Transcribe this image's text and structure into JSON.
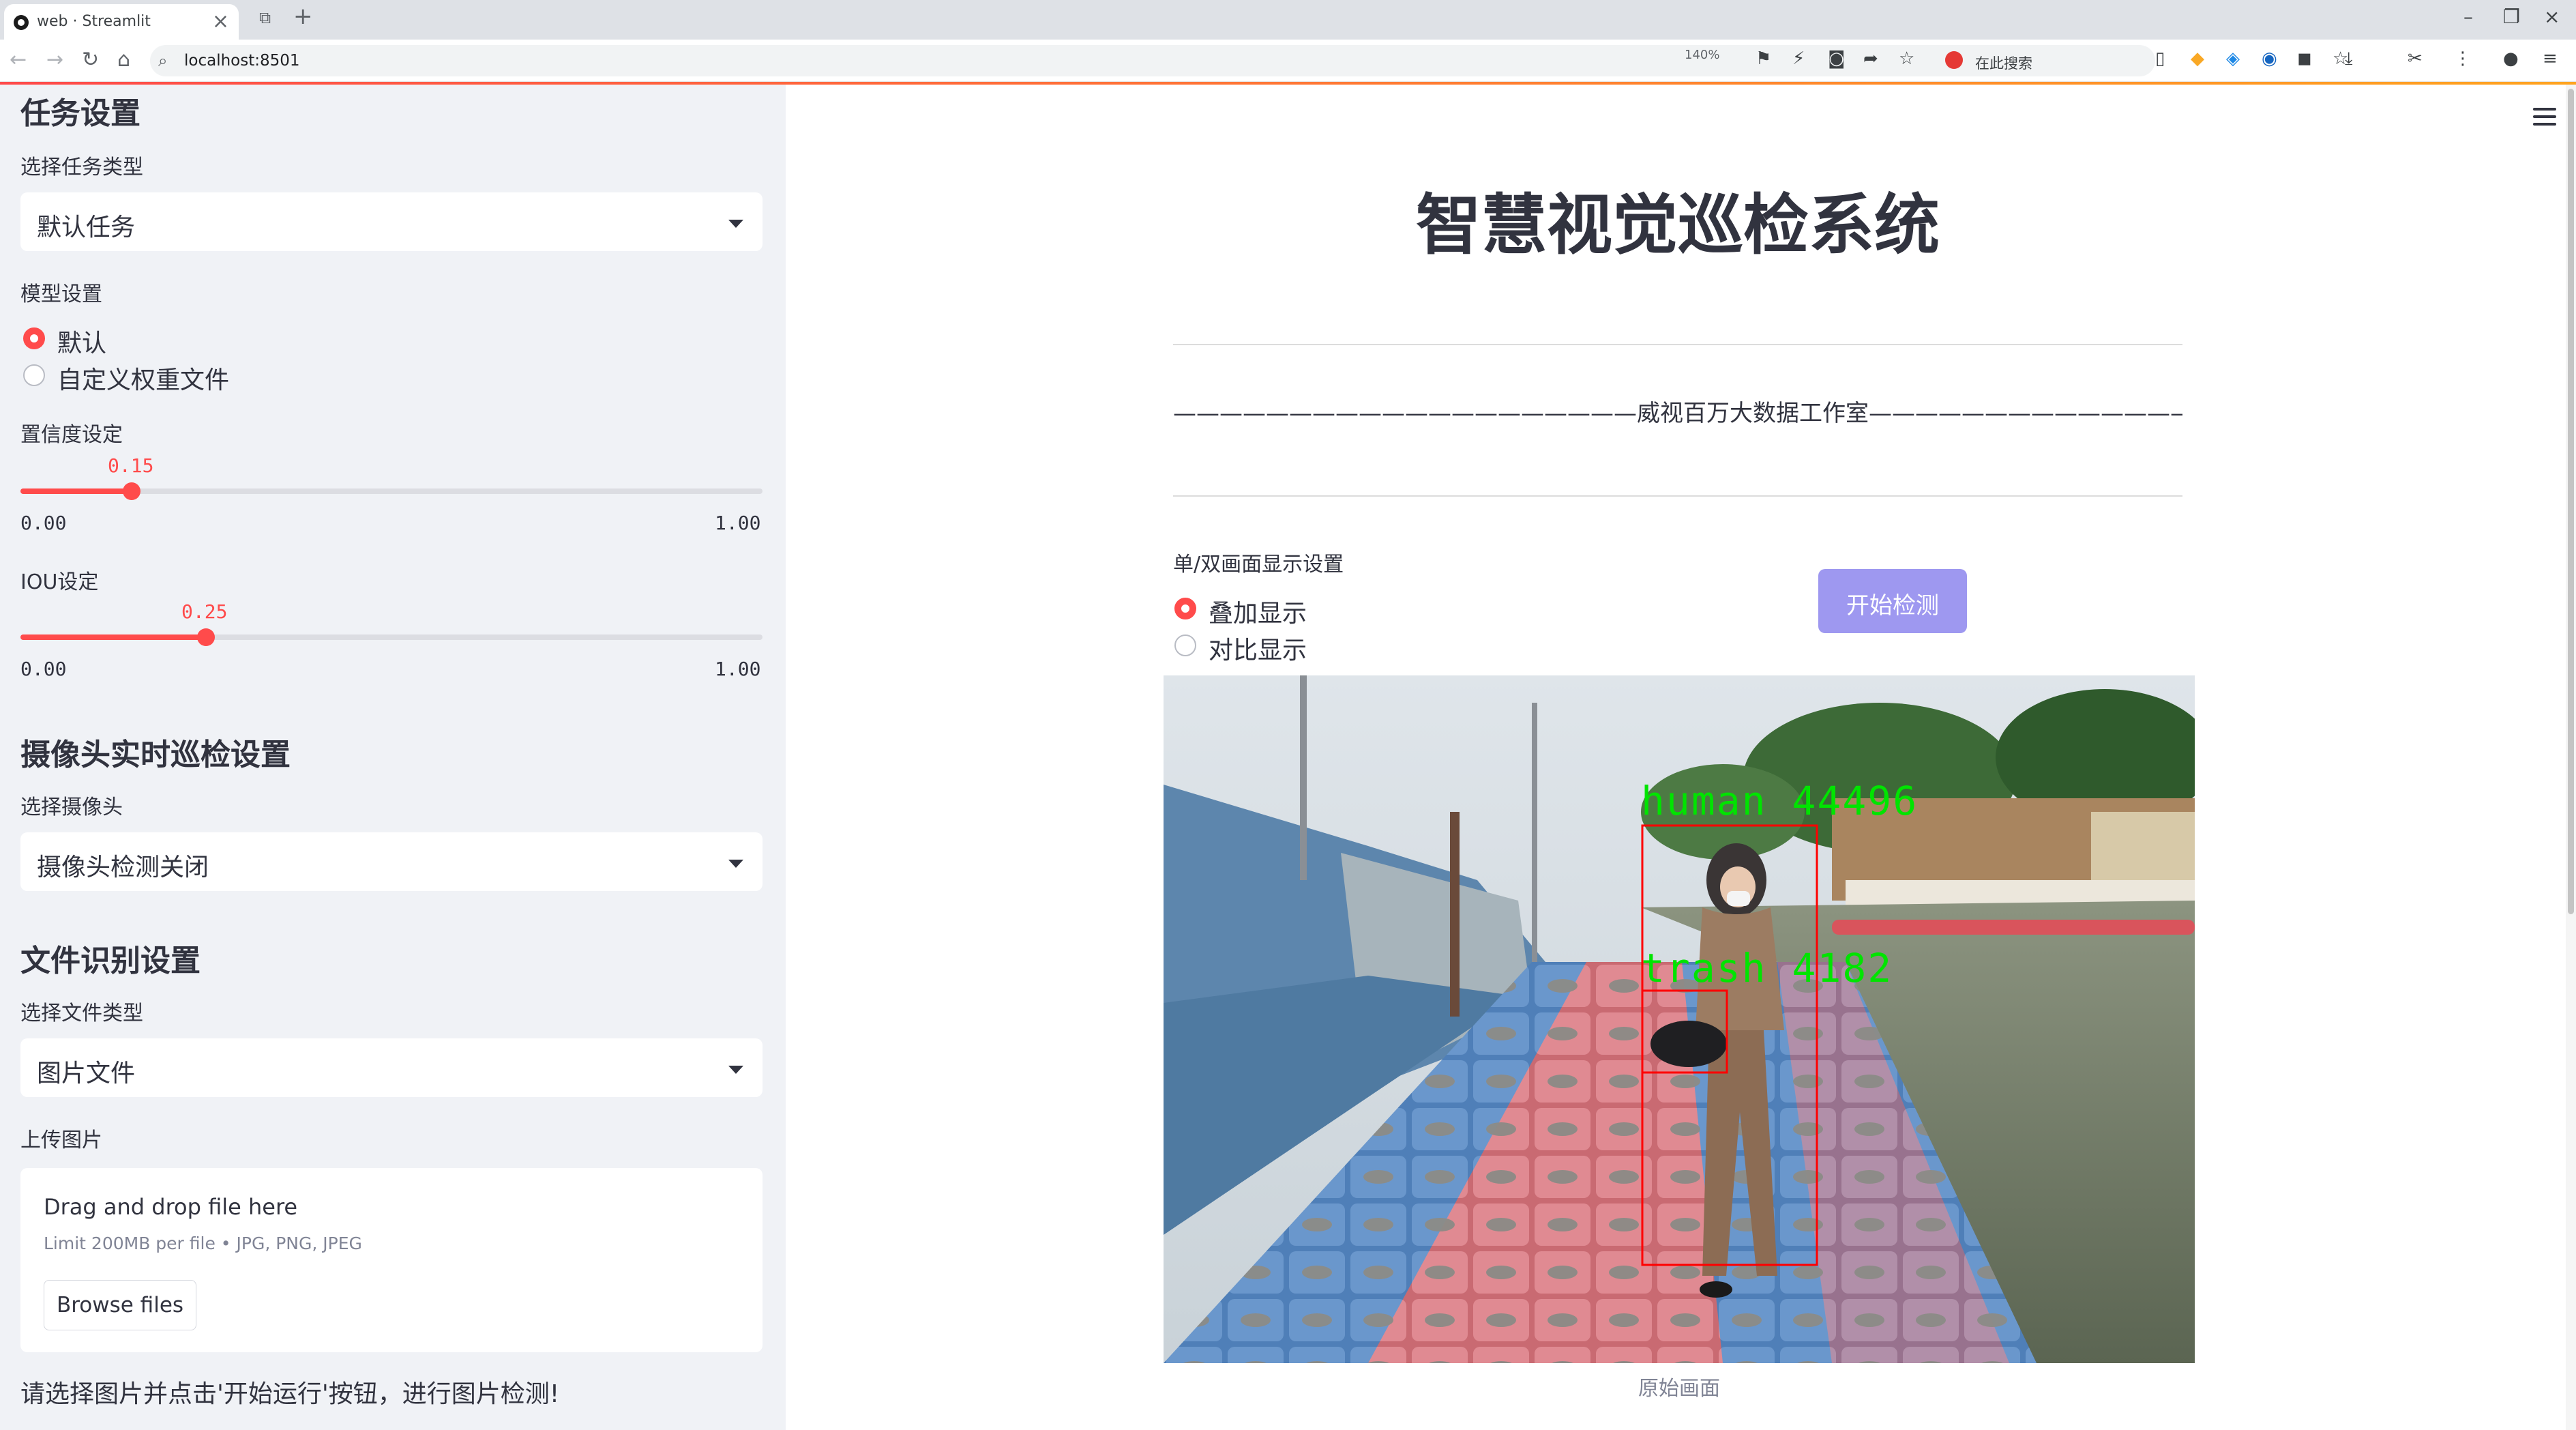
{
  "browser": {
    "tab_title": "web · Streamlit",
    "url": "localhost:8501",
    "zoom": "140%",
    "search_text": "在此搜索"
  },
  "sidebar": {
    "task_section": {
      "heading": "任务设置",
      "select_label": "选择任务类型",
      "select_value": "默认任务"
    },
    "model_section": {
      "label": "模型设置",
      "options": [
        "默认",
        "自定义权重文件"
      ],
      "selected_index": 0
    },
    "confidence": {
      "label": "置信度设定",
      "value_text": "0.15",
      "value": 0.15,
      "min": "0.00",
      "max": "1.00"
    },
    "iou": {
      "label": "IOU设定",
      "value_text": "0.25",
      "value": 0.25,
      "min": "0.00",
      "max": "1.00"
    },
    "camera_section": {
      "heading": "摄像头实时巡检设置",
      "select_label": "选择摄像头",
      "select_value": "摄像头检测关闭"
    },
    "file_section": {
      "heading": "文件识别设置",
      "select_label": "选择文件类型",
      "select_value": "图片文件"
    },
    "upload": {
      "label": "上传图片",
      "drop_text": "Drag and drop file here",
      "limit_text": "Limit 200MB per file • JPG, PNG, JPEG",
      "button_label": "Browse files"
    },
    "note": "请选择图片并点击'开始运行'按钮，进行图片检测!"
  },
  "main": {
    "title": "智慧视觉巡检系统",
    "studio_line": "————————————————————威视百万大数据工作室—————————————————————",
    "display_mode": {
      "label": "单/双画面显示设置",
      "options": [
        "叠加显示",
        "对比显示"
      ],
      "selected_index": 0
    },
    "run_button": "开始检测",
    "detections": [
      {
        "label": "human",
        "score": "44496"
      },
      {
        "label": "trash",
        "score": "4182"
      }
    ],
    "image_caption": "原始画面"
  },
  "colors": {
    "accent": "#ff4b4b",
    "sidebar_bg": "#f0f2f6",
    "run_button": "#9e98f0",
    "detection_text": "#00e400",
    "detection_box": "#ff0000"
  },
  "icons": {
    "tab_favicon": "streamlit-logo-icon",
    "menu": "hamburger-menu-icon",
    "select_caret": "chevron-down-icon"
  }
}
